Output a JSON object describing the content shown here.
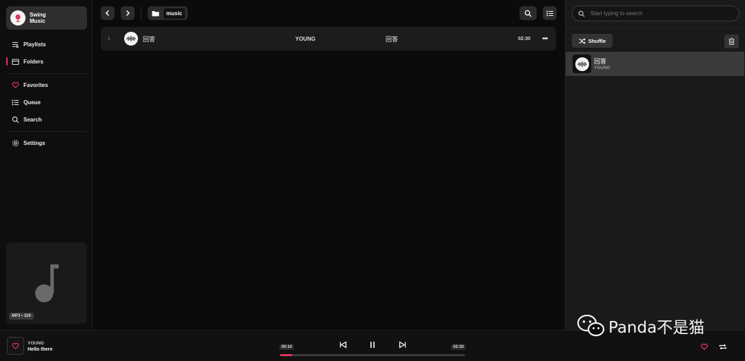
{
  "app": {
    "name": "Swing\nMusic",
    "colors": {
      "accent": "#e2345b",
      "sidebar": "#0e0e0e",
      "panel": "#1a1a1a"
    }
  },
  "sidebar": {
    "items": [
      {
        "label": "Playlists",
        "icon": "playlist-icon"
      },
      {
        "label": "Folders",
        "icon": "folder-icon",
        "active": true
      },
      {
        "label": "Favorites",
        "icon": "heart-icon"
      },
      {
        "label": "Queue",
        "icon": "list-icon"
      },
      {
        "label": "Search",
        "icon": "search-icon"
      },
      {
        "label": "Settings",
        "icon": "gear-icon"
      }
    ],
    "now_playing_tag": "MP3 • 320"
  },
  "toolbar": {
    "breadcrumb": "music"
  },
  "tracks": [
    {
      "index": "1",
      "title": "回答",
      "artist": "YOUNG",
      "album": "回答",
      "duration": "02:30",
      "more": "•••"
    }
  ],
  "queue_panel": {
    "search_placeholder": "Start typing to search",
    "shuffle_label": "Shuffle",
    "items": [
      {
        "title": "回答",
        "artist": "YOUNG"
      }
    ]
  },
  "player": {
    "artist": "YOUNG",
    "title": "Hello there",
    "elapsed": "00:10",
    "total": "02:30",
    "progress_fraction": 0.0667
  },
  "watermark": "Panda不是猫"
}
